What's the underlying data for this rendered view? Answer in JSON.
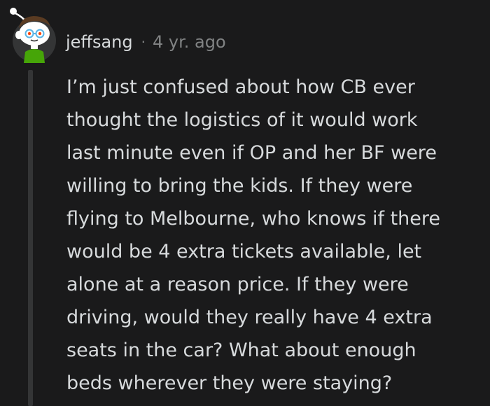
{
  "comment": {
    "username": "jeffsang",
    "separator": "·",
    "timestamp": "4 yr. ago",
    "body_lines": [
      "I’m just confused about how CB ever",
      "thought the logistics of it would work",
      "last minute even if OP and her BF were",
      "willing to bring the kids. If they were",
      "flying to Melbourne, who knows if there",
      "would be 4 extra tickets available, let",
      "alone at a reason price. If they were",
      "driving, would they really have 4 extra",
      "seats in the car? What about enough",
      "beds wherever they were staying?"
    ]
  },
  "colors": {
    "background": "#1a1a1b",
    "text": "#d7dadc",
    "muted": "#818384",
    "thread_line": "#343536",
    "avatar_circle": "#343536",
    "avatar_shirt": "#46a508"
  },
  "icons": {
    "avatar": "snoo-avatar-icon"
  }
}
